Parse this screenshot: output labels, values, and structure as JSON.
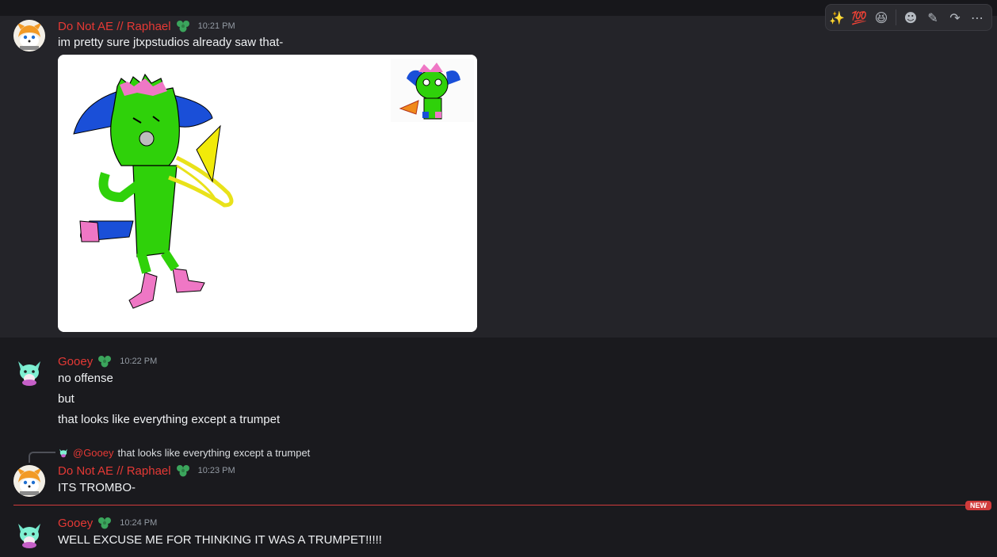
{
  "toolbar": {
    "reactions": [
      "✨",
      "💯",
      "😆"
    ],
    "actions": {
      "add_reaction": "☻",
      "edit": "✎",
      "forward": "↷",
      "more": "⋯"
    }
  },
  "messages": [
    {
      "author": "Do Not AE // Raphael",
      "time": "10:21 PM",
      "lines": [
        "im pretty sure jtxpstudios already saw that-"
      ]
    },
    {
      "author": "Gooey",
      "time": "10:22 PM",
      "lines": [
        "no offense",
        "but",
        "that looks like everything except a trumpet"
      ]
    },
    {
      "reply_to": {
        "mention": "@Gooey",
        "text": "that looks like everything except a trumpet"
      },
      "author": "Do Not AE // Raphael",
      "time": "10:23 PM",
      "lines": [
        "ITS TROMBO-"
      ]
    },
    {
      "author": "Gooey",
      "time": "10:24 PM",
      "lines": [
        "WELL EXCUSE ME FOR THINKING IT WAS A TRUMPET!!!!!"
      ]
    }
  ],
  "divider": {
    "label": "NEW"
  },
  "colors": {
    "username": "#e53935",
    "background": "#1a1a1e",
    "hover": "#242429",
    "new_divider": "#d13b3b",
    "role_icon": "#3ba55c"
  },
  "icons": [
    "sparkles-icon",
    "hundred-points-icon",
    "laughing-emoji-icon",
    "add-reaction-icon",
    "edit-icon",
    "forward-icon",
    "more-icon",
    "role-badge-icon"
  ]
}
